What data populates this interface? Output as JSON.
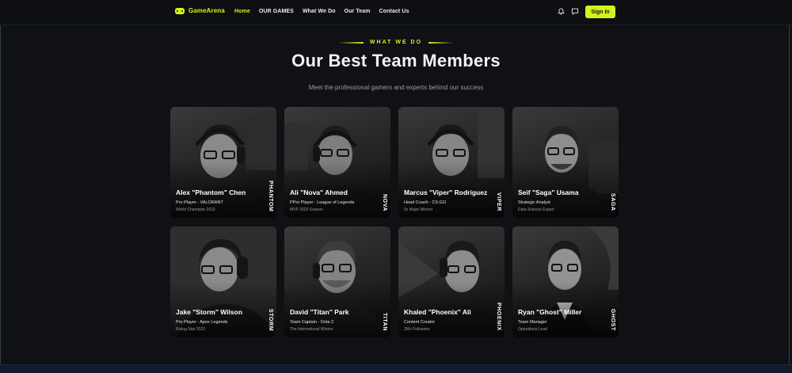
{
  "nav": {
    "logo": "GameArena",
    "links": [
      "Home",
      "OUR GAMES",
      "What We Do",
      "Our Team",
      "Contact Us"
    ],
    "active_link": "Home",
    "sign_in": "Sign In",
    "icons": [
      "bell-icon",
      "chat-icon"
    ]
  },
  "section": {
    "eyebrow": "WHAT WE DO",
    "title": "Our Best Team Members",
    "subtitle": "Meet the professional gamers and experts behind our success"
  },
  "members": [
    {
      "name": "Alex \"Phantom\" Chen",
      "role": "Pro Player - VALORANT",
      "award": "World Champion 2023",
      "tag": "PHANTOM"
    },
    {
      "name": "Ali \"Nova\" Ahmed",
      "role": "PPro Player - League of Legends",
      "award": "MVP 2023 Season",
      "tag": "NOVA"
    },
    {
      "name": "Marcus \"Viper\" Rodriguez",
      "role": "Head Coach - CS:GO",
      "award": "5x Major Winner",
      "tag": "VIPER"
    },
    {
      "name": "Seif \"Saga\" Usama",
      "role": "Strategic Analyst",
      "award": "Data Science Expert",
      "tag": "SAGA"
    },
    {
      "name": "Jake \"Storm\" Wilson",
      "role": "Pro Player - Apex Legends",
      "award": "Rising Star 2023",
      "tag": "STORM"
    },
    {
      "name": "David \"Titan\" Park",
      "role": "Team Captain - Dota 2",
      "award": "The International Winner",
      "tag": "TITAN"
    },
    {
      "name": "Khaled \"Phoenix\" Ali",
      "role": "Content Creator",
      "award": "2M+ Followers",
      "tag": "PHOENIX"
    },
    {
      "name": "Ryan \"Ghost\" Miller",
      "role": "Team Manager",
      "award": "Operations Lead",
      "tag": "GHOST"
    }
  ],
  "colors": {
    "accent": "#d4f21c",
    "background": "#0f1115"
  }
}
